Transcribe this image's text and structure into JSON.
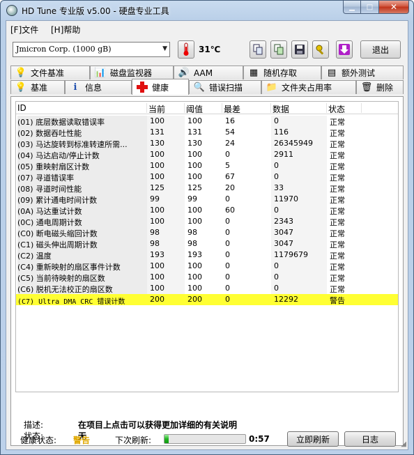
{
  "window": {
    "title": "HD Tune 专业版 v5.00 - 硬盘专业工具"
  },
  "menu": [
    "[F]文件",
    "[H]帮助"
  ],
  "toolbar": {
    "drive": "Jmicron Corp. (1000 gB)",
    "temperature": "31℃",
    "exit_label": "退出"
  },
  "tabs_top": [
    "文件基准",
    "磁盘监视器",
    "AAM",
    "随机存取",
    "额外测试"
  ],
  "tabs_bottom": [
    "基准",
    "信息",
    "健康",
    "错误扫描",
    "文件夹占用率",
    "删除"
  ],
  "active_tab": "健康",
  "columns": [
    "ID",
    "当前",
    "阈值",
    "最差",
    "数据",
    "状态"
  ],
  "rows": [
    {
      "id": "(01) 底层数据读取错误率",
      "cur": "100",
      "thr": "100",
      "worst": "16",
      "data": "0",
      "status": "正常"
    },
    {
      "id": "(02) 数据吞吐性能",
      "cur": "131",
      "thr": "131",
      "worst": "54",
      "data": "116",
      "status": "正常"
    },
    {
      "id": "(03) 马达旋转到标准转速所需...",
      "cur": "130",
      "thr": "130",
      "worst": "24",
      "data": "26345949",
      "status": "正常"
    },
    {
      "id": "(04) 马达启动/停止计数",
      "cur": "100",
      "thr": "100",
      "worst": "0",
      "data": "2911",
      "status": "正常"
    },
    {
      "id": "(05) 重映射扇区计数",
      "cur": "100",
      "thr": "100",
      "worst": "5",
      "data": "0",
      "status": "正常"
    },
    {
      "id": "(07) 寻道错误率",
      "cur": "100",
      "thr": "100",
      "worst": "67",
      "data": "0",
      "status": "正常"
    },
    {
      "id": "(08) 寻道时间性能",
      "cur": "125",
      "thr": "125",
      "worst": "20",
      "data": "33",
      "status": "正常"
    },
    {
      "id": "(09) 累计通电时间计数",
      "cur": "99",
      "thr": "99",
      "worst": "0",
      "data": "11970",
      "status": "正常"
    },
    {
      "id": "(0A) 马达重试计数",
      "cur": "100",
      "thr": "100",
      "worst": "60",
      "data": "0",
      "status": "正常"
    },
    {
      "id": "(0C) 通电周期计数",
      "cur": "100",
      "thr": "100",
      "worst": "0",
      "data": "2343",
      "status": "正常"
    },
    {
      "id": "(C0) 断电磁头缩回计数",
      "cur": "98",
      "thr": "98",
      "worst": "0",
      "data": "3047",
      "status": "正常"
    },
    {
      "id": "(C1) 磁头伸出周期计数",
      "cur": "98",
      "thr": "98",
      "worst": "0",
      "data": "3047",
      "status": "正常"
    },
    {
      "id": "(C2) 温度",
      "cur": "193",
      "thr": "193",
      "worst": "0",
      "data": "1179679",
      "status": "正常"
    },
    {
      "id": "(C4) 重新映射的扇区事件计数",
      "cur": "100",
      "thr": "100",
      "worst": "0",
      "data": "0",
      "status": "正常"
    },
    {
      "id": "(C5) 当前待映射的扇区数",
      "cur": "100",
      "thr": "100",
      "worst": "0",
      "data": "0",
      "status": "正常"
    },
    {
      "id": "(C6) 脱机无法校正的扇区数",
      "cur": "100",
      "thr": "100",
      "worst": "0",
      "data": "0",
      "status": "正常"
    },
    {
      "id": "(C7) Ultra DMA CRC 错误计数",
      "cur": "200",
      "thr": "200",
      "worst": "0",
      "data": "12292",
      "status": "警告"
    }
  ],
  "desc": {
    "label": "描述:",
    "value": "在项目上点击可以获得更加详细的有关说明"
  },
  "state": {
    "label": "状态:",
    "value": "无"
  },
  "health": {
    "label": "健康状态:",
    "value": "警告",
    "color": "#e0a800"
  },
  "refresh": {
    "label": "下次刷新:",
    "time": "0:57",
    "progress": 0.05
  },
  "buttons": {
    "refresh_now": "立即刷新",
    "log": "日志"
  },
  "colors": {
    "warn_row": "#ffff33"
  }
}
